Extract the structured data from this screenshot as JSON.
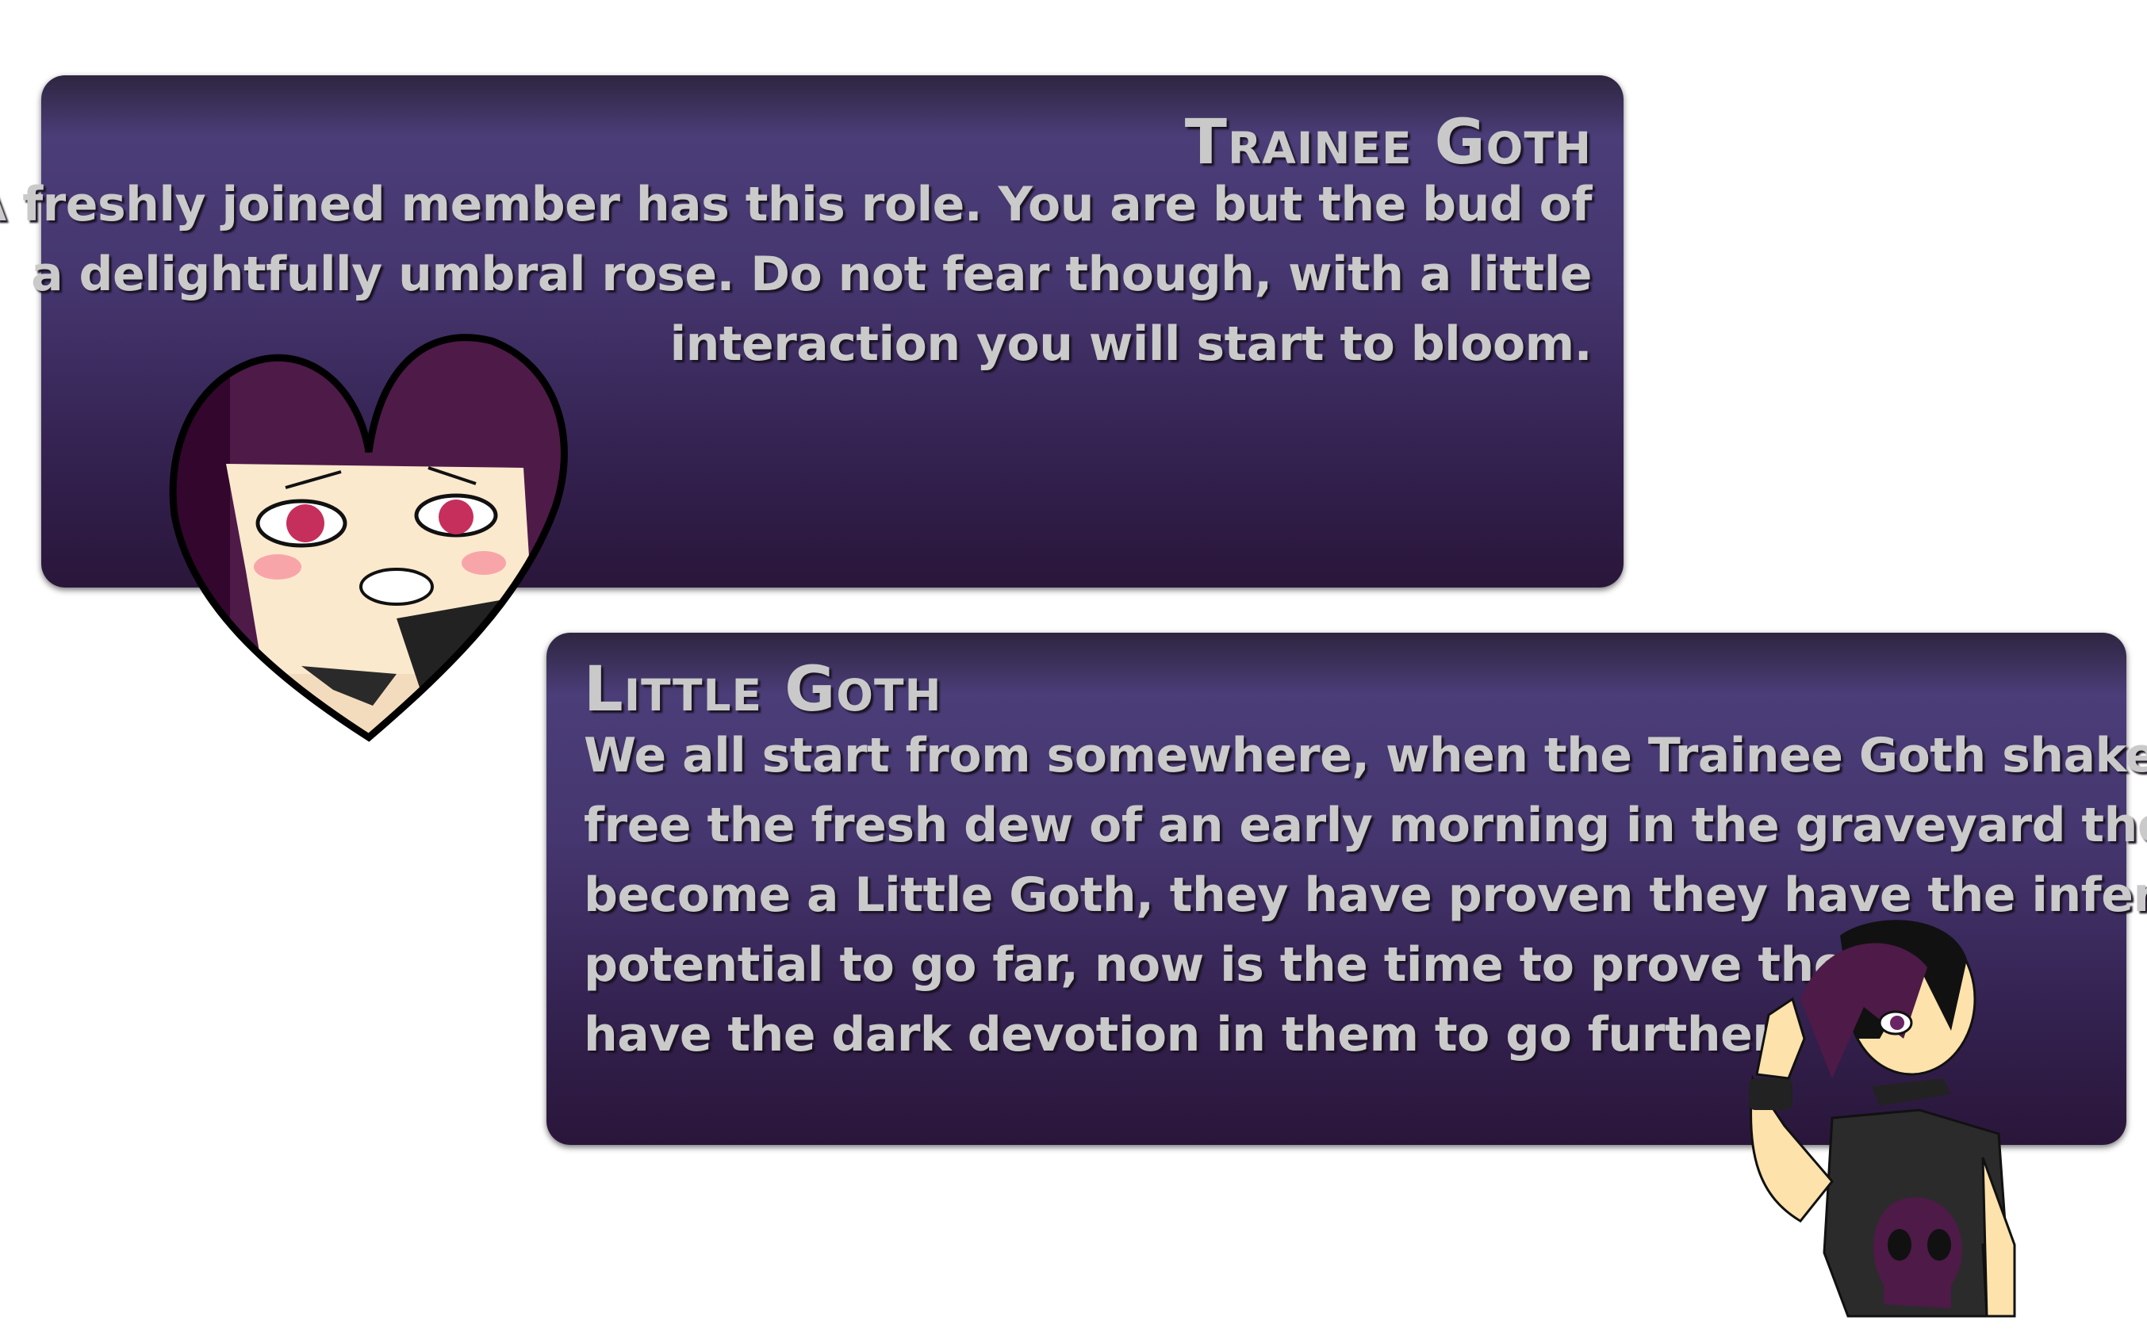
{
  "roles": [
    {
      "title": "Trainee Goth",
      "lines": [
        "A freshly joined member has this role. You are but the bud of",
        "a delightfully umbral rose. Do not fear though, with a little",
        "interaction you will start to bloom."
      ]
    },
    {
      "title": "Little Goth",
      "lines": [
        "We all start from somewhere, when the Trainee Goth shakes",
        "free the fresh dew of an early morning in the graveyard they",
        "become a Little Goth, they have proven they have the infernal",
        "potential to go far, now is the time to prove they",
        "have the dark devotion in them to go further."
      ]
    }
  ],
  "colors": {
    "card_top": "#4b3d78",
    "card_bottom": "#2a163a",
    "text": "#c9c9c9"
  }
}
